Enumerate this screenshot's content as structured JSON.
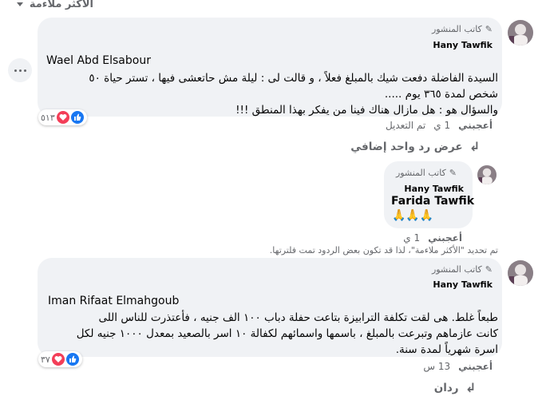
{
  "sort": {
    "label": "الأكثر ملاءمة"
  },
  "colors": {
    "like": "#1877f2",
    "love": "#f33e58",
    "bubble": "#f0f2f5",
    "muted": "#65676b"
  },
  "comments": [
    {
      "author_badge": "كاتب المنشور",
      "author_name": "Hany Tawfik",
      "mention": "Wael Abd Elsabour",
      "lines": [
        "السيدة الفاضلة دفعت شيك بالمبلغ فعلاً ، و قالت لى : ليلة مش حاتعشى فيها ، تستر حياة ٥٠",
        "شخص لمدة ٣٦٥ يوم .....",
        "والسؤال هو : هل مازال هناك فينا من يفكر بهذا المنطق !!!"
      ],
      "reaction_count": "٥١٣",
      "actions": {
        "like": "أعجبني",
        "time": "1 ي",
        "edited": "تم التعديل"
      }
    },
    {
      "author_badge": "كاتب المنشور",
      "author_name": "Hany Tawfik",
      "mention": "Farida Tawfik",
      "emoji": "🙏🙏🙏",
      "actions": {
        "like": "أعجبني",
        "time": "1 ي"
      }
    },
    {
      "author_badge": "كاتب المنشور",
      "author_name": "Hany Tawfik",
      "mention": "Iman Rifaat Elmahgoub",
      "lines": [
        "طبعاً غلط. هى لقت تكلفة الترابيزة بتاعت حفلة دباب ١٠٠ الف جنيه ، فأعتذرت للناس اللى",
        "كانت عازماهم وتبرعت بالمبلغ ، باسمها واسمائهم لكفالة ١٠ اسر بالصعيد بمعدل ١٠٠٠ جنيه لكل",
        "اسرة شهرياً لمدة سنة."
      ],
      "reaction_count": "٣٧",
      "actions": {
        "like": "أعجبني",
        "time": "13 س"
      }
    }
  ],
  "view_more_reply": "عرض رد واحد إضافي",
  "filter_note": "تم تحديد \"الأكثر ملاءمة\"، لذا قد تكون بعض الردود تمت فلترتها.",
  "replies_label": "ردان"
}
